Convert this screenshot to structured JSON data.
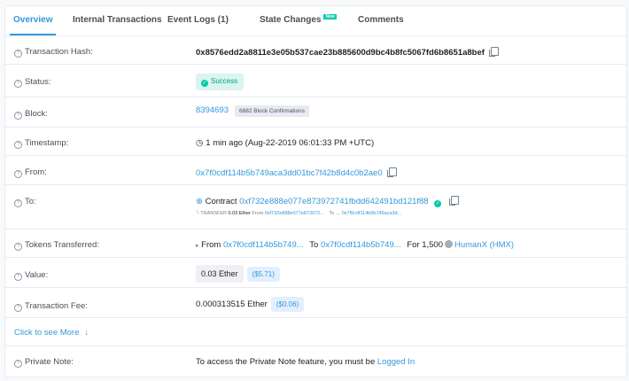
{
  "tabs": [
    {
      "label": "Overview"
    },
    {
      "label": "Internal Transactions"
    },
    {
      "label": "Event Logs (1)"
    },
    {
      "label": "State Changes",
      "badge": "New"
    },
    {
      "label": "Comments"
    }
  ],
  "rows": {
    "tx_hash": {
      "label": "Transaction Hash:",
      "value": "0x8576edd2a8811e3e05b537cae23b885600d9bc4b8fc5067fd6b8651a8bef"
    },
    "status": {
      "label": "Status:",
      "value": "Success"
    },
    "block": {
      "label": "Block:",
      "value": "8394693",
      "confirmations": "6882 Block Confirmations"
    },
    "timestamp": {
      "label": "Timestamp:",
      "value": "1 min ago (Aug-22-2019 06:01:33 PM +UTC)"
    },
    "from": {
      "label": "From:",
      "value": "0x7f0cdf114b5b749aca3dd01bc7f42b8d4c0b2ae0"
    },
    "to": {
      "label": "To:",
      "contract_prefix": "Contract",
      "value": "0xf732e888e077e873972741fbdd642491bd121f88",
      "transfer_label": "TRANSFER",
      "transfer_amount": "0.03 Ether",
      "from_word": "From",
      "transfer_from": "0xf732e888e077e873972...",
      "to_word": "To",
      "transfer_to": "0x7f0cdf114b5b749aca3d..."
    },
    "tokens": {
      "label": "Tokens Transferred:",
      "from_word": "From",
      "from": "0x7f0cdf114b5b749...",
      "to_word": "To",
      "to": "0x7f0cdf114b5b749...",
      "for_word": "For",
      "amount": "1,500",
      "token": "HumanX (HMX)"
    },
    "value": {
      "label": "Value:",
      "ether": "0.03 Ether",
      "usd": "($5.71)"
    },
    "fee": {
      "label": "Transaction Fee:",
      "ether": "0.000313515 Ether",
      "usd": "($0.06)"
    },
    "more": {
      "label": "Click to see More"
    },
    "note": {
      "label": "Private Note:",
      "text": "To access the Private Note feature, you must be",
      "link": "Logged In"
    }
  },
  "colors": {
    "accent": "#3498db",
    "success": "#00c9a7"
  }
}
